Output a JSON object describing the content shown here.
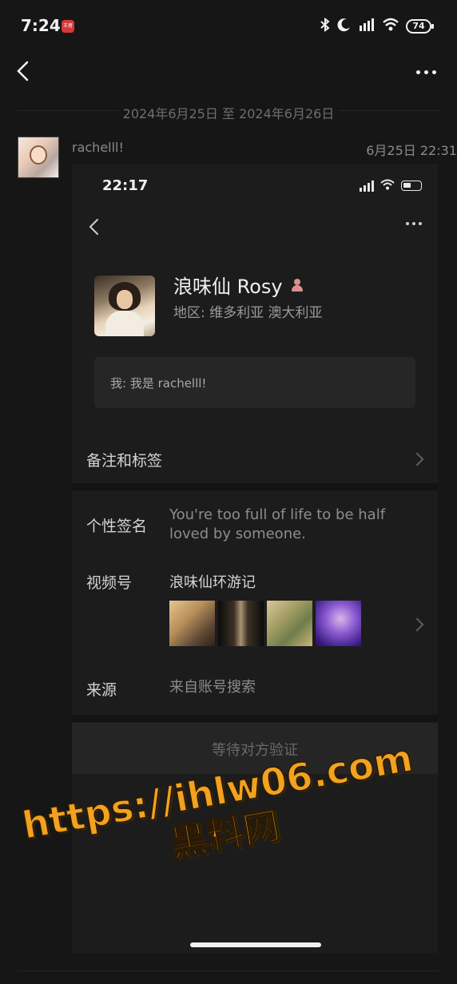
{
  "status_bar": {
    "time": "7:24",
    "app_badge_text": "王者",
    "battery": "74"
  },
  "conversation": {
    "date_range": "2024年6月25日 至 2024年6月26日",
    "message": {
      "sender": "rachelll!",
      "time": "6月25日 22:31"
    }
  },
  "screenshot": {
    "status_time": "22:17",
    "profile": {
      "name": "浪味仙 Rosy",
      "region": "地区: 维多利亚 澳大利亚",
      "greeting": "我: 我是 rachelll!"
    },
    "rows": {
      "remark_label": "备注和标签",
      "signature_label": "个性签名",
      "signature_value_line1": "You're too full of life to be half",
      "signature_value_line2": "loved by someone.",
      "channel_label": "视频号",
      "channel_name": "浪味仙环游记",
      "source_label": "来源",
      "source_value": "来自账号搜索"
    },
    "wait_button": "等待对方验证"
  },
  "watermark": {
    "line1": "https://ihlw06.com",
    "line2": "黑料网"
  },
  "colors": {
    "watermark": "#f2a21e",
    "background": "#161616",
    "card": "#1c1c1c"
  }
}
